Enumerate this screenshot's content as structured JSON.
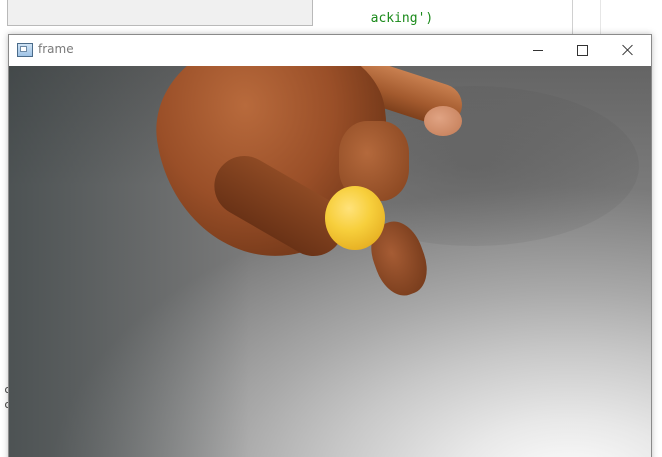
{
  "editor": {
    "code_line_1_fragment": "acking')",
    "code_line_2_fragment": "",
    "left_mark_1": "c",
    "left_mark_2": "c"
  },
  "frame_window": {
    "title": "frame",
    "icon": "app-window-icon",
    "controls": {
      "minimize_icon": "minimize-icon",
      "maximize_icon": "maximize-icon",
      "close_icon": "close-icon"
    }
  },
  "camera": {
    "subject": "yellow-ball",
    "colors": {
      "ball": "#f7cf3c",
      "skin": "#9a4f28",
      "background": "#a9a9a9"
    }
  }
}
